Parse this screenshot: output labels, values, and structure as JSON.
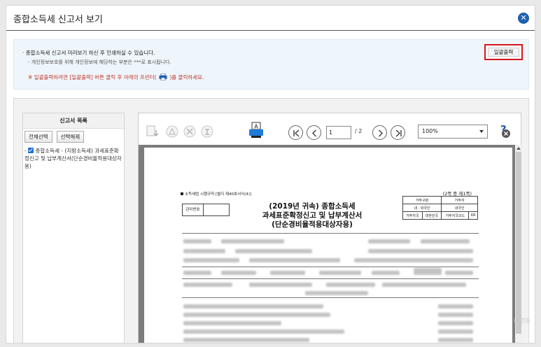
{
  "window": {
    "title": "종합소득세 신고서 보기",
    "close_icon": "close-icon"
  },
  "notice": {
    "line1": "· 종합소득세 신고서 미리보기 하신 후 인쇄하실 수 있습니다.",
    "line2": "- 개인정보보호를 위해 개인정보에 해당하는 부분은 ***로 표시됩니다.",
    "line3_prefix": "※ 일괄출력하려면 [일괄출력] 버튼 클릭 후 아래의 프린터(",
    "line3_suffix": ")를 클릭하세요.",
    "batch_print_label": "일괄출력",
    "highlight_color": "#d3151c"
  },
  "left_panel": {
    "header": "신고서 목록",
    "select_all_label": "전체선택",
    "deselect_label": "선택해제",
    "items": [
      {
        "label": "종합소득세 - (지방소득세) 과세표준확정신고 및 납부계산서(단순경비율적용대상자용)",
        "checked": true
      }
    ]
  },
  "viewer": {
    "toolbar_icons": [
      "save-icon",
      "pdf-icon",
      "excel-icon",
      "hwp-icon",
      "print-icon"
    ],
    "page_current": "1",
    "page_total": "/ 2",
    "zoom": "100%",
    "nav_icons": [
      "first-page-icon",
      "prev-page-icon",
      "next-page-icon",
      "last-page-icon"
    ],
    "close_viewer_icon": "help-close-icon"
  },
  "document": {
    "form_header": "소득세법 시행규칙 [별지 제40호서식(4)]",
    "page_count": "(2쪽 중 제1쪽)",
    "mgmt_label": "관리번호",
    "title_lines": [
      "(2019년 귀속) 종합소득세",
      "과세표준확정신고 및 납부계산서",
      "(단순경비율적용대상자용)"
    ],
    "residency_table": [
      [
        "거주구분",
        "거주자"
      ],
      [
        "내 · 외국인",
        "내국인"
      ],
      [
        "거주지국",
        "대한민국",
        "거주지국코드",
        "KR"
      ]
    ]
  },
  "watermark": "표 연등"
}
